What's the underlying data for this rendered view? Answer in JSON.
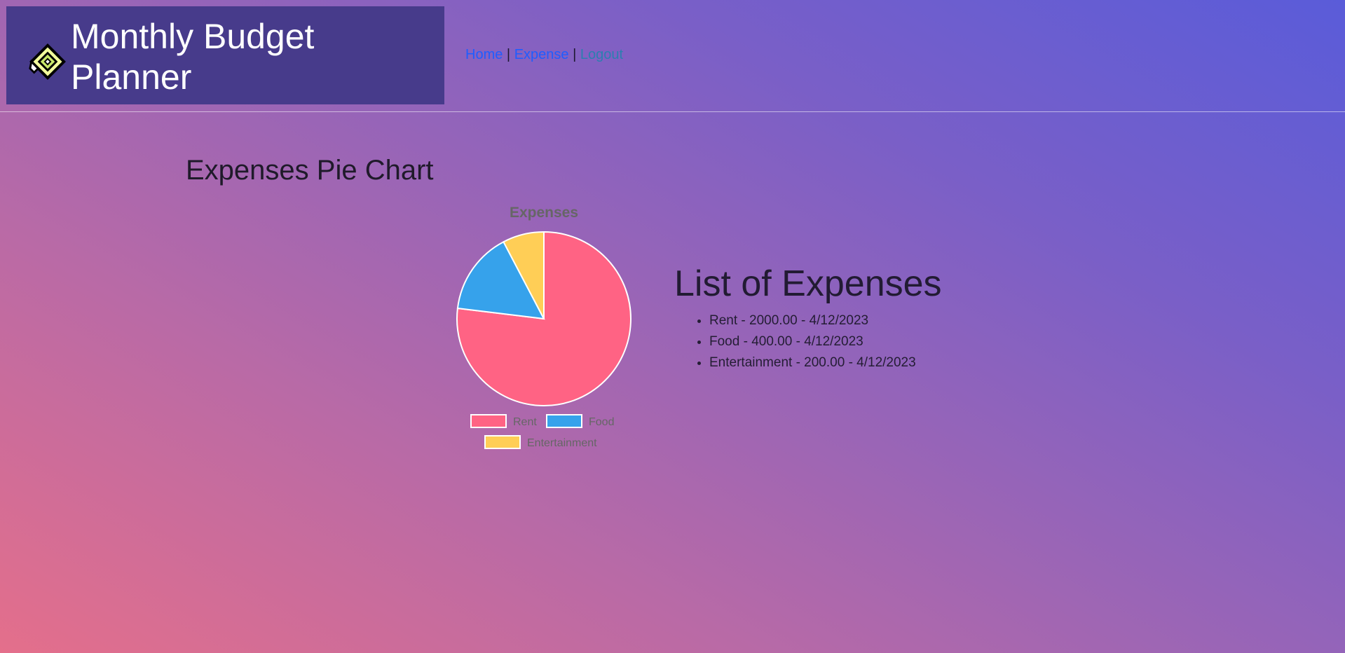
{
  "header": {
    "title": "Monthly Budget Planner",
    "logo_icon": "puzzle-diamond-icon",
    "nav": {
      "home": "Home",
      "separator": "|",
      "expense": "Expense",
      "logout": "Logout"
    }
  },
  "main": {
    "section_title": "Expenses Pie Chart",
    "list_title": "List of Expenses",
    "expenses": [
      "Rent - 2000.00 - 4/12/2023",
      "Food - 400.00 - 4/12/2023",
      "Entertainment - 200.00 - 4/12/2023"
    ]
  },
  "chart_data": {
    "type": "pie",
    "title": "Expenses",
    "categories": [
      "Rent",
      "Food",
      "Entertainment"
    ],
    "values": [
      2000,
      400,
      200
    ],
    "colors": [
      "#ff6384",
      "#36a2eb",
      "#ffce56"
    ],
    "legend": "bottom"
  }
}
